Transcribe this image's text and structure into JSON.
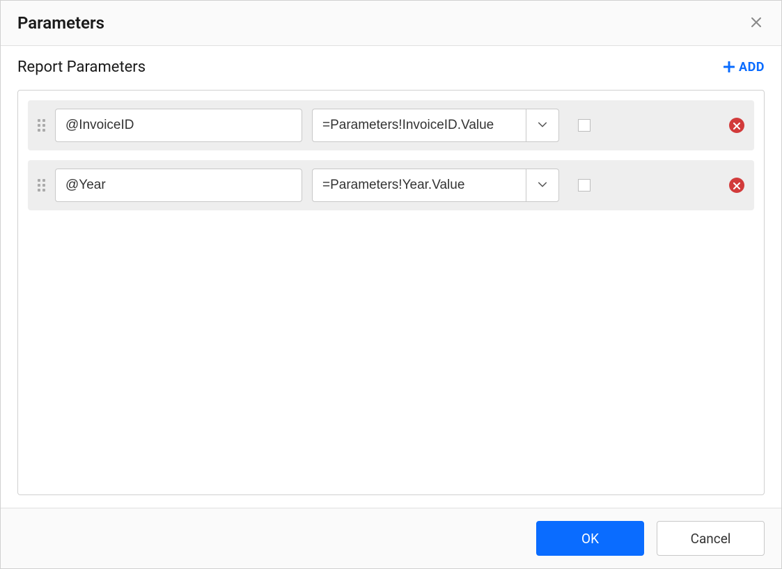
{
  "dialog": {
    "title": "Parameters",
    "section_title": "Report Parameters",
    "add_label": "ADD",
    "ok_label": "OK",
    "cancel_label": "Cancel"
  },
  "parameters": [
    {
      "name": "@InvoiceID",
      "value": "=Parameters!InvoiceID.Value",
      "checked": false
    },
    {
      "name": "@Year",
      "value": "=Parameters!Year.Value",
      "checked": false
    }
  ]
}
